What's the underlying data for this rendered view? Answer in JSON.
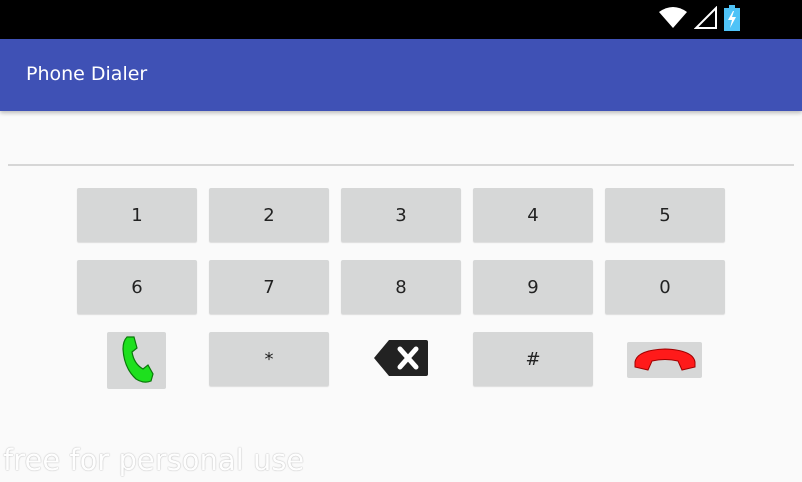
{
  "status_bar": {
    "icons": [
      "wifi-icon",
      "cell-signal-icon",
      "battery-charging-icon"
    ]
  },
  "app_bar": {
    "title": "Phone Dialer"
  },
  "input": {
    "value": "",
    "placeholder": ""
  },
  "keypad": {
    "row1": [
      "1",
      "2",
      "3",
      "4",
      "5"
    ],
    "row2": [
      "6",
      "7",
      "8",
      "9",
      "0"
    ],
    "row3": {
      "call_icon": "phone-call-icon",
      "star": "*",
      "backspace_icon": "backspace-icon",
      "hash": "#",
      "hangup_icon": "phone-hangup-icon"
    }
  },
  "watermark": "free for personal use",
  "colors": {
    "status_bar": "#000000",
    "app_bar": "#3f51b5",
    "background": "#fafafa",
    "key": "#d6d7d7",
    "call_green": "#1ee01e",
    "hangup_red": "#ff1a1a",
    "battery": "#4fc3f7"
  }
}
